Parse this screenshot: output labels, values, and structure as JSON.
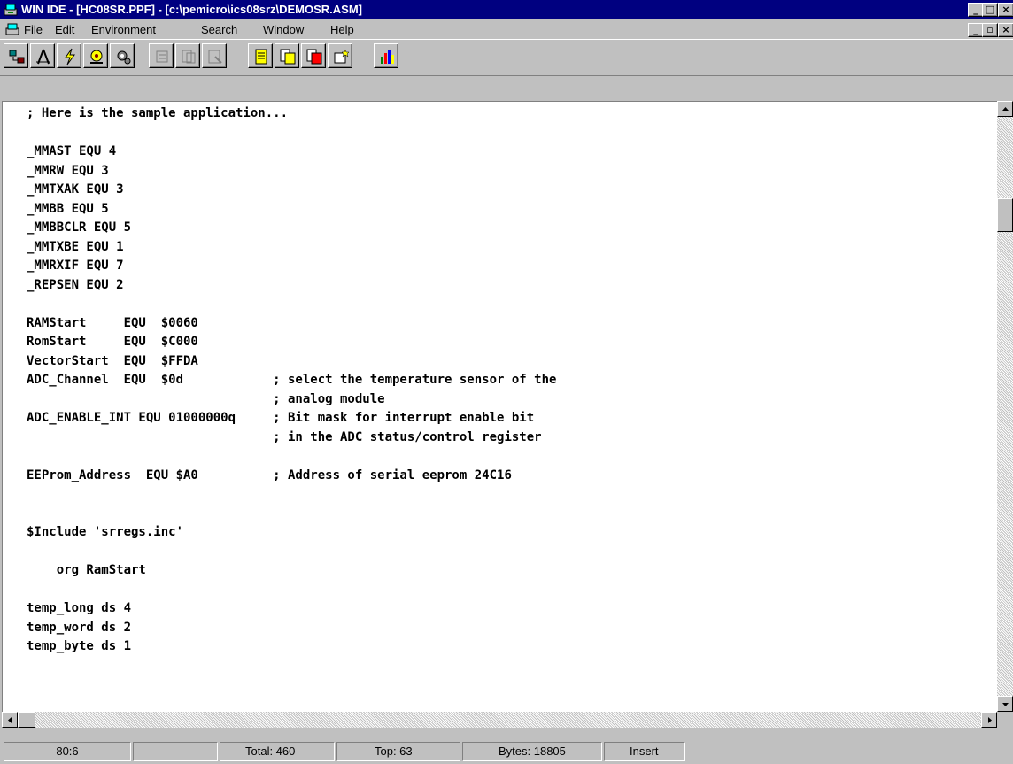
{
  "window": {
    "title": "WIN IDE - [HC08SR.PPF] - [c:\\pemicro\\ics08srz\\DEMOSR.ASM]",
    "buttons": {
      "minimize": "_",
      "maximize": "□",
      "close": "×"
    },
    "child_buttons": {
      "minimize": "_",
      "restore": "▫",
      "close": "×"
    }
  },
  "menu": {
    "items": [
      {
        "pre": "",
        "key": "F",
        "post": "ile"
      },
      {
        "pre": "",
        "key": "E",
        "post": "dit"
      },
      {
        "pre": "En",
        "key": "v",
        "post": "ironment"
      },
      {
        "pre": "",
        "key": "S",
        "post": "earch"
      },
      {
        "pre": "",
        "key": "W",
        "post": "indow"
      },
      {
        "pre": "",
        "key": "H",
        "post": "elp"
      }
    ]
  },
  "toolbar": {
    "buttons": [
      "network-icon",
      "compass-icon",
      "lightning-icon",
      "debug-target-icon",
      "gear-icon",
      "disabled-tool-icon-1",
      "disabled-tool-icon-2",
      "disabled-tool-icon-3",
      "document-icon",
      "copy-document-icon",
      "red-document-icon",
      "document-star-icon",
      "bar-chart-icon"
    ]
  },
  "editor": {
    "lines": [
      "; Here is the sample application...",
      "",
      "_MMAST EQU 4",
      "_MMRW EQU 3",
      "_MMTXAK EQU 3",
      "_MMBB EQU 5",
      "_MMBBCLR EQU 5",
      "_MMTXBE EQU 1",
      "_MMRXIF EQU 7",
      "_REPSEN EQU 2",
      "",
      "RAMStart     EQU  $0060",
      "RomStart     EQU  $C000",
      "VectorStart  EQU  $FFDA",
      "ADC_Channel  EQU  $0d            ; select the temperature sensor of the",
      "                                 ; analog module",
      "ADC_ENABLE_INT EQU 01000000q     ; Bit mask for interrupt enable bit",
      "                                 ; in the ADC status/control register",
      "",
      "EEProm_Address  EQU $A0          ; Address of serial eeprom 24C16",
      "",
      "",
      "$Include 'srregs.inc'",
      "",
      "    org RamStart",
      "",
      "temp_long ds 4",
      "temp_word ds 2",
      "temp_byte ds 1"
    ]
  },
  "statusbar": {
    "position": "80:6",
    "blank": "",
    "total": "Total: 460",
    "top": "Top: 63",
    "bytes": "Bytes: 18805",
    "mode": "Insert"
  }
}
